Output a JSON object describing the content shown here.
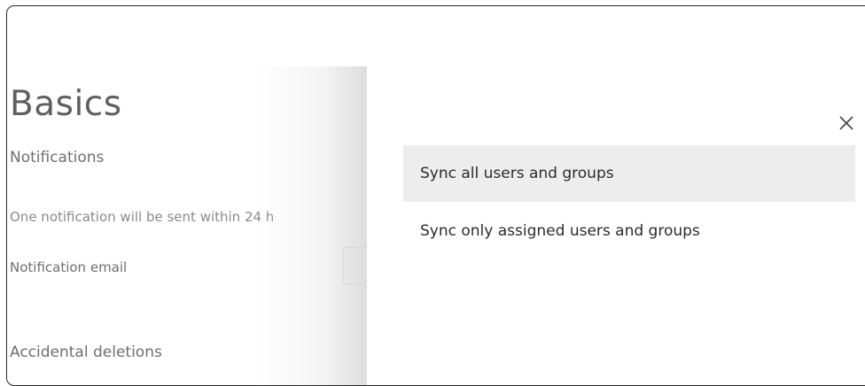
{
  "page": {
    "title": "Basics",
    "notifications_heading": "Notifications",
    "notifications_description": "One notification will be sent within 24 h",
    "notification_email_label": "Notification email",
    "accidental_deletions_heading": "Accidental deletions"
  },
  "flyout": {
    "close_icon": "close-icon",
    "options": [
      {
        "label": "Sync all users and groups",
        "selected": true
      },
      {
        "label": "Sync only assigned users and groups",
        "selected": false
      }
    ]
  },
  "icons": {
    "collapse": "chevron-up-icon",
    "close": "close-icon"
  },
  "colors": {
    "selected_option_bg": "#ededed",
    "text_primary": "#2b2b2b",
    "text_dimmed": "#6f6f6f"
  }
}
